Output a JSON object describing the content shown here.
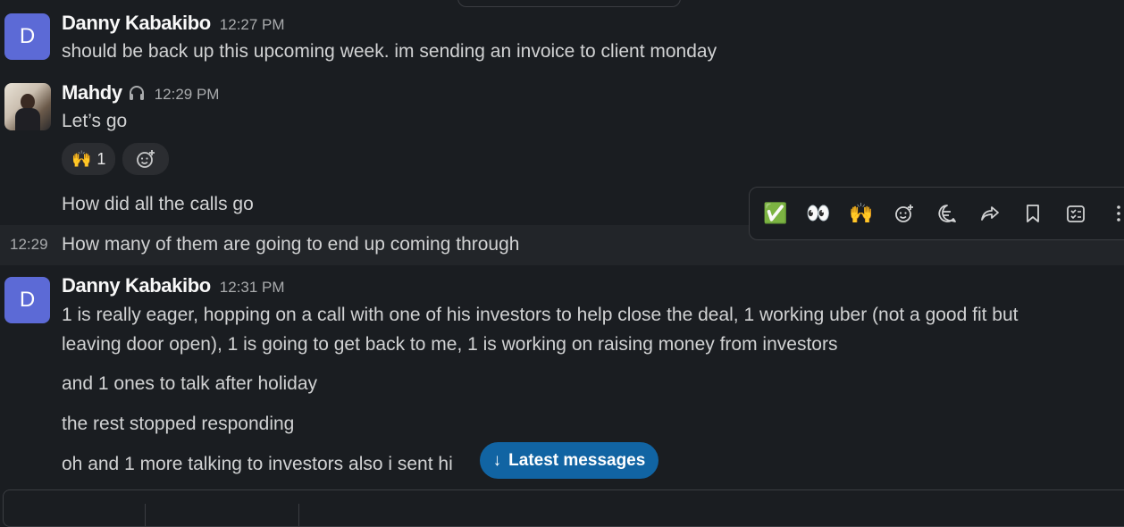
{
  "messages": [
    {
      "author": "Danny Kabakibo",
      "avatar_letter": "D",
      "time": "12:27 PM",
      "text": "should be back up this upcoming week. im sending an invoice to client monday"
    },
    {
      "author": "Mahdy",
      "status_icon": "headset-icon",
      "time": "12:29 PM",
      "text": "Let’s go",
      "reactions": [
        {
          "emoji": "🙌",
          "count": "1"
        }
      ],
      "followups": [
        {
          "text": "How did all the calls go"
        },
        {
          "time": "12:29",
          "text": "How many of them are going to end up coming through"
        }
      ]
    },
    {
      "author": "Danny Kabakibo",
      "avatar_letter": "D",
      "time": "12:31 PM",
      "paragraphs": [
        "1 is really eager, hopping on a call with one of his investors to help close the deal, 1 working uber (not a good fit but leaving door open), 1 is going to get back to me, 1 is working on raising money from investors",
        "and 1 ones to talk after holiday",
        "the rest stopped responding",
        "oh and 1 more talking to investors also i sent hi"
      ]
    }
  ],
  "toolbar": {
    "items": [
      "✅",
      "👀",
      "🙌",
      "add-reaction-icon",
      "reply-thread-icon",
      "forward-icon",
      "bookmark-icon",
      "add-task-icon",
      "more-icon"
    ]
  },
  "latest_button": {
    "label": "Latest messages",
    "arrow": "↓"
  },
  "colors": {
    "background": "#1a1d21",
    "hover_row": "#222529",
    "avatar": "#5c6ad6",
    "accent_button": "#1164a3"
  }
}
